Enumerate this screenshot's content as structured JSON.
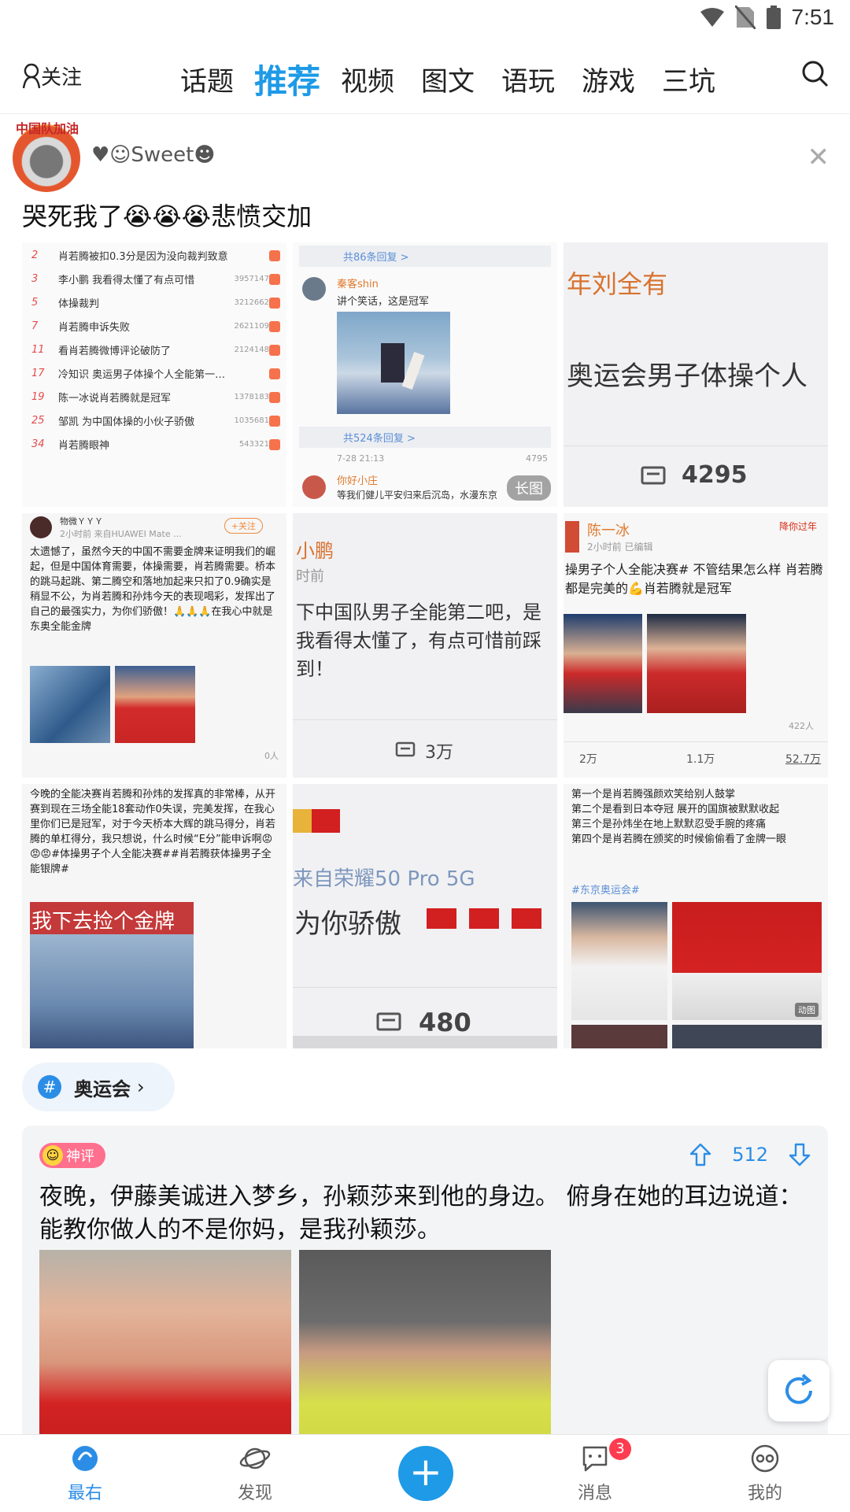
{
  "status_bar": {
    "time": "7:51"
  },
  "top_nav": {
    "follow_label": "关注",
    "tabs": [
      "话题",
      "推荐",
      "视频",
      "图文",
      "语玩",
      "游戏",
      "三坑"
    ],
    "active_tab": "推荐"
  },
  "post": {
    "username": "♥☺Sweet☻",
    "avatar_text": "中国队加油",
    "text": "哭死我了😭😭😭悲愤交加",
    "images": {
      "c1_rows": [
        {
          "num": "2",
          "text": "肖若腾被扣0.3分是因为没向裁判致意",
          "count": ""
        },
        {
          "num": "3",
          "text": "李小鹏 我看得太懂了有点可惜",
          "count": "3957147"
        },
        {
          "num": "5",
          "text": "体操裁判",
          "count": "3212662"
        },
        {
          "num": "7",
          "text": "肖若腾申诉失败",
          "count": "2621109"
        },
        {
          "num": "11",
          "text": "看肖若腾微博评论破防了",
          "count": "2124148"
        },
        {
          "num": "17",
          "text": "冷知识 奥运男子体操个人全能第一…",
          "count": ""
        },
        {
          "num": "19",
          "text": "陈一冰说肖若腾就是冠军",
          "count": "1378183"
        },
        {
          "num": "25",
          "text": "邹凯 为中国体操的小伙子骄傲",
          "count": "1035681"
        },
        {
          "num": "34",
          "text": "肖若腾眼神",
          "count": "543321"
        }
      ],
      "c2_reply1": "共86条回复 >",
      "c2_user1": "秦客shin",
      "c2_comment1": "讲个笑话，这是冠军",
      "c2_reply2": "共524条回复 >",
      "c2_date": "7-28 21:13",
      "c2_likes": "4795",
      "c2_user2": "你好小庄",
      "c2_comment2": "等我们健儿平安归来后沉岛，水漫东京",
      "c2_long_tag": "长图",
      "c3_line1": "年刘全有",
      "c3_line2": "奥运会男子体操个人",
      "c3_count": "4295",
      "c4_user": "物微ＹＹＹ",
      "c4_meta": "2小时前 来自HUAWEI Mate ...",
      "c4_follow": "+关注",
      "c4_text": "太遗憾了，虽然今天的中国不需要金牌来证明我们的崛起，但是中国体育需要，体操需要，肖若腾需要。桥本的跳马起跳、第二腾空和落地加起来只扣了0.9确实是稍显不公，为肖若腾和孙炜今天的表现喝彩，发挥出了自己的最强实力，为你们骄傲！🙏🙏🙏在我心中就是东奥全能金牌",
      "c4_foot": "0人",
      "c5_user": "小鹏",
      "c5_time": "时前",
      "c5_text": "下中国队男子全能第二吧，是我看得太懂了，有点可惜前踩到！",
      "c5_count": "3万",
      "c6_user": "陈一冰",
      "c6_badge": "降你过年",
      "c6_meta": "2小时前   已编辑",
      "c6_text": "操男子个人全能决赛# 不管结果怎么样 肖若腾都是完美的💪肖若腾就是冠军",
      "c6_people": "422人",
      "c6_stats": [
        "2万",
        "1.1万",
        "52.7万"
      ],
      "c7_text": "今晚的全能决赛肖若腾和孙炜的发挥真的非常棒，从开赛到现在三场全能18套动作0失误，完美发挥，在我心里你们已是冠军，对于今天桥本大辉的跳马得分，肖若腾的单杠得分，我只想说，什么时候“E分”能申诉啊😡😡😡#体操男子个人全能决赛##肖若腾获体操男子全能银牌#",
      "c7_caption": "我下去捡个金牌",
      "c8_line1": "来自荣耀50 Pro 5G",
      "c8_line2": "为你骄傲",
      "c8_count": "480",
      "c9_text": "第一个是肖若腾强颜欢笑给别人鼓掌\n第二个是看到日本夺冠 展开的国旗被默默收起\n第三个是孙炜坐在地上默默忍受手腕的疼痛\n第四个是肖若腾在颁奖的时候偷偷看了金牌一眼",
      "c9_tag": "#东京奥运会#",
      "c9_gif": "动图"
    }
  },
  "topic": {
    "name": "奥运会"
  },
  "comment": {
    "badge": "神评",
    "votes": "512",
    "text": "夜晚，伊藤美诚进入梦乡，孙颖莎来到他的身边。 俯身在她的耳边说道：能教你做人的不是你妈，是我孙颖莎。"
  },
  "bottom_nav": {
    "items": [
      "最右",
      "发现",
      "消息",
      "我的"
    ],
    "messages_badge": "3"
  },
  "colors": {
    "accent": "#1e9ae6",
    "badge": "#ff3b4f"
  }
}
